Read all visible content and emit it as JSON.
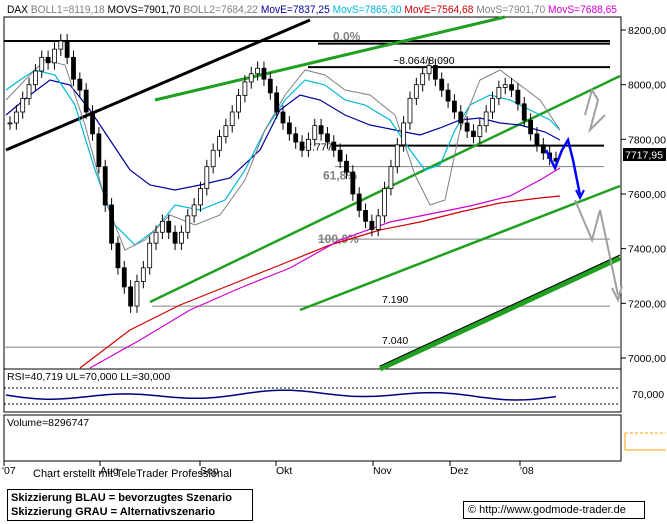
{
  "header": {
    "symbol": "DAX",
    "indicators": [
      {
        "text": "BOLL1=8119,18",
        "color": "#808080"
      },
      {
        "text": "MOVS=7901,70",
        "color": "#000000"
      },
      {
        "text": "BOLL2=7684,22",
        "color": "#808080"
      },
      {
        "text": "MovE=7837,25",
        "color": "#0000a0"
      },
      {
        "text": "MovS=7865,30",
        "color": "#00b8d8"
      },
      {
        "text": "MovE=7564,68",
        "color": "#d00000"
      },
      {
        "text": "MovS=7901,70",
        "color": "#808080"
      },
      {
        "text": "MovS=7688,65",
        "color": "#d000d0"
      }
    ]
  },
  "chart_data": {
    "type": "candlestick",
    "y_axis": {
      "ticks": [
        "8200,00",
        "8000,00",
        "7800,00",
        "7600,00",
        "7400,00",
        "7200,00",
        "7000,00"
      ],
      "ylim": [
        6960,
        8260
      ]
    },
    "x_axis": {
      "ticks": [
        "'07",
        "Aug",
        "Sep",
        "Okt",
        "Nov",
        "Dez",
        "'08"
      ]
    },
    "last_price_label": "7717,95",
    "levels": [
      {
        "label": "0,0%",
        "value": 8150
      },
      {
        "label": "~8.064/8.090",
        "value": 8064
      },
      {
        "label": "~7.777",
        "value": 7777
      },
      {
        "label": "61,8%",
        "value": 7700
      },
      {
        "label": "100,0%",
        "value": 7435
      },
      {
        "label": "7.190",
        "value": 7190
      },
      {
        "label": "7.040",
        "value": 7040
      }
    ],
    "rsi": {
      "label": "RSI=40,719 UL=70,000 LL=30,000",
      "tick": "70,000"
    },
    "volume": {
      "label": "Volume=8296747"
    },
    "colors": {
      "bollinger": "#808080",
      "ema": "#0000a0",
      "sma_fast": "#00b8d8",
      "ema_slow": "#d00000",
      "sma_mid": "#d000d0",
      "trend": "#20a020",
      "scenario_blue": "#0000ff",
      "scenario_grey": "#a0a0a0",
      "candle": "#000000"
    }
  },
  "footer": {
    "credit": "Chart erstellt mit TeleTrader Professional",
    "legend_blue": "Skizzierung BLAU = bevorzugtes Szenario",
    "legend_grey": "Skizzierung GRAU = Alternativszenario",
    "source": "© http://www.godmode-trader.de"
  }
}
